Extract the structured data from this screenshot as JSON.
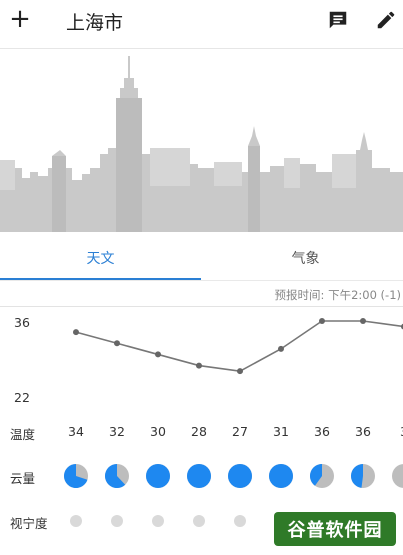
{
  "header": {
    "add_symbol": "+",
    "city": "上海市",
    "message_icon": "message-icon",
    "edit_icon": "pencil-icon"
  },
  "tabs": [
    {
      "label": "天文",
      "active": true
    },
    {
      "label": "气象",
      "active": false
    }
  ],
  "forecast_time": "预报时间: 下午2:00 (-1)",
  "colors": {
    "accent": "#2a7fd4",
    "cloud_blue": "#1e88f0",
    "cloud_gray": "#bdbdbd",
    "skyline": "#c8c8c8"
  },
  "chart_data": {
    "type": "line",
    "ylabel_top": "36",
    "ylabel_bottom": "22",
    "ylim": [
      22,
      36
    ],
    "values": [
      34,
      32,
      30,
      28,
      27,
      31,
      36,
      36,
      35
    ]
  },
  "rows": {
    "temp_label": "温度",
    "cloud_label": "云量",
    "seeing_label": "视宁度"
  },
  "temps": [
    "34",
    "32",
    "30",
    "28",
    "27",
    "31",
    "36",
    "36",
    "3"
  ],
  "cloud_cover": [
    0.7,
    0.62,
    1.0,
    1.0,
    1.0,
    1.0,
    0.4,
    0.48,
    0.0
  ],
  "watermark": "谷普软件园"
}
